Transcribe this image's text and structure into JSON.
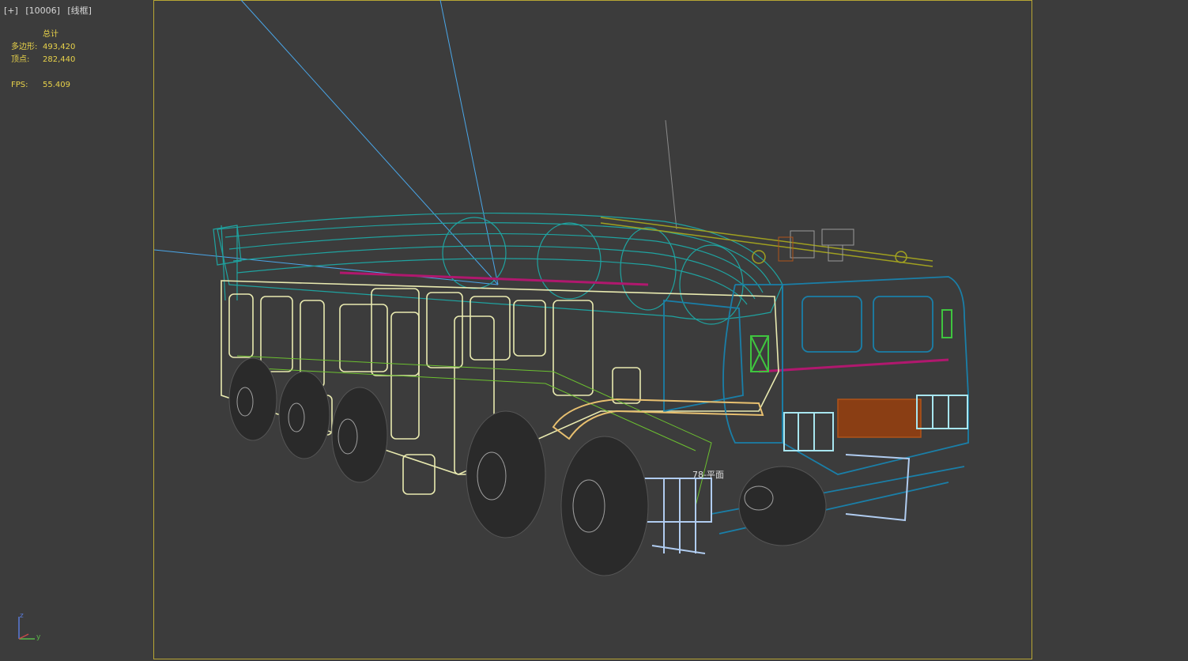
{
  "viewport": {
    "label_parts": [
      "[+]",
      "[10006]",
      "[线框]"
    ],
    "stats": {
      "header": "总计",
      "polygons_label": "多边形:",
      "polygons_value": "493,420",
      "vertices_label": "顶点:",
      "vertices_value": "282,440",
      "fps_label": "FPS:",
      "fps_value": "55.409"
    },
    "grid_label": "78-平面",
    "axis": {
      "x_label": "",
      "y_label": "y",
      "z_label": "z"
    }
  },
  "colors": {
    "background": "#3c3c3c",
    "safe_frame": "#b8a634",
    "stats_text": "#e8d24a",
    "wire_cyan": "#1fa3a0",
    "wire_yellow": "#e9eab0",
    "wire_teal": "#1a7fa8",
    "wire_magenta": "#b0186e",
    "wire_green": "#3fc43f",
    "wire_orange": "#b0531a",
    "wire_lightblue": "#a8d4f0",
    "wire_gray": "#8a8a8a",
    "camera_line": "#4aa6e8"
  }
}
